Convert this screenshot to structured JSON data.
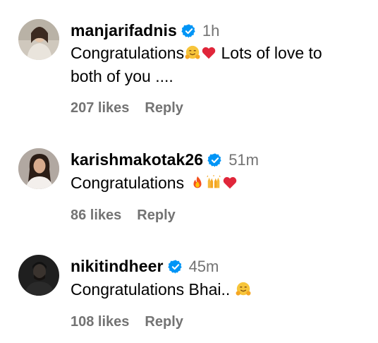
{
  "comments": [
    {
      "username": "manjarifadnis",
      "verified": true,
      "time": "1h",
      "text_line1": "Congratulations",
      "text_after_emoji": " Lots of love to",
      "text_line2": "both of you ....",
      "emojis": [
        "smiling-hug-emoji",
        "red-heart-emoji"
      ],
      "likes": "207 likes",
      "reply": "Reply"
    },
    {
      "username": "karishmakotak26",
      "verified": true,
      "time": "51m",
      "text": "Congratulations ",
      "emojis": [
        "fire-emoji",
        "raised-hands-emoji",
        "red-heart-emoji"
      ],
      "likes": "86 likes",
      "reply": "Reply"
    },
    {
      "username": "nikitindheer",
      "verified": true,
      "time": "45m",
      "text": "Congratulations Bhai.. ",
      "emojis": [
        "smiling-hug-emoji"
      ],
      "likes": "108 likes",
      "reply": "Reply"
    }
  ],
  "colors": {
    "verified_blue": "#0095f6",
    "muted_text": "#737373",
    "heart_red": "#e0263a"
  }
}
